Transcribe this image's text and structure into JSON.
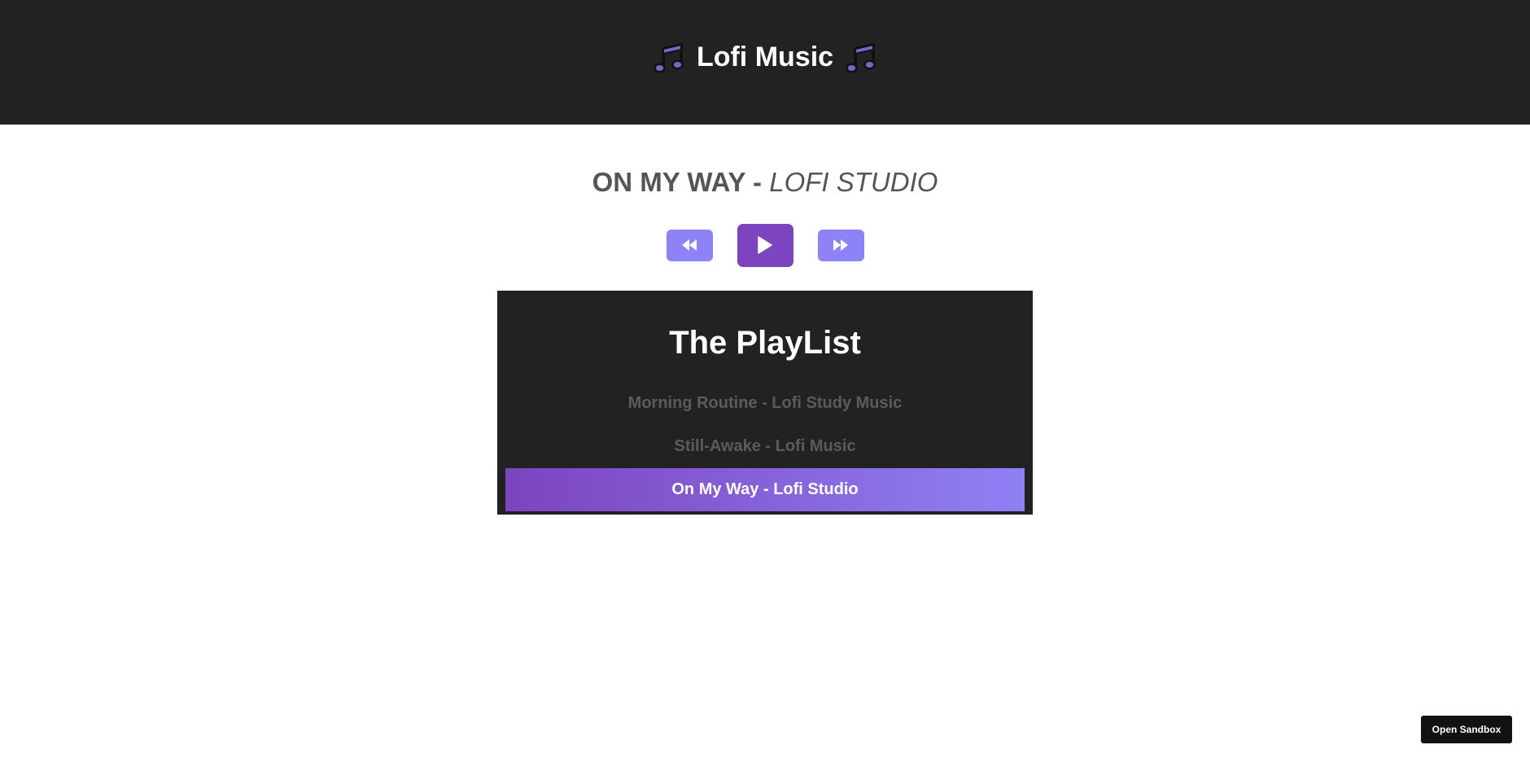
{
  "header": {
    "title": "Lofi Music",
    "left_icon": "music-note-icon",
    "right_icon": "music-note-icon"
  },
  "now_playing": {
    "title": "On My Way",
    "separator": " - ",
    "artist": "Lofi Studio"
  },
  "controls": {
    "prev_icon": "backward-icon",
    "play_icon": "play-icon",
    "next_icon": "forward-icon"
  },
  "playlist": {
    "heading": "The PlayList",
    "items": [
      {
        "label": "Morning Routine - Lofi Study Music",
        "active": false
      },
      {
        "label": "Still-Awake - Lofi Music",
        "active": false
      },
      {
        "label": "On My Way - Lofi Studio",
        "active": true
      }
    ]
  },
  "sandbox": {
    "label": "Open Sandbox"
  },
  "colors": {
    "header_bg": "#222222",
    "accent_purple": "#7c44bf",
    "accent_lavender": "#8d82f6",
    "muted_text": "#555555",
    "inactive_item": "#5b5b5b"
  }
}
